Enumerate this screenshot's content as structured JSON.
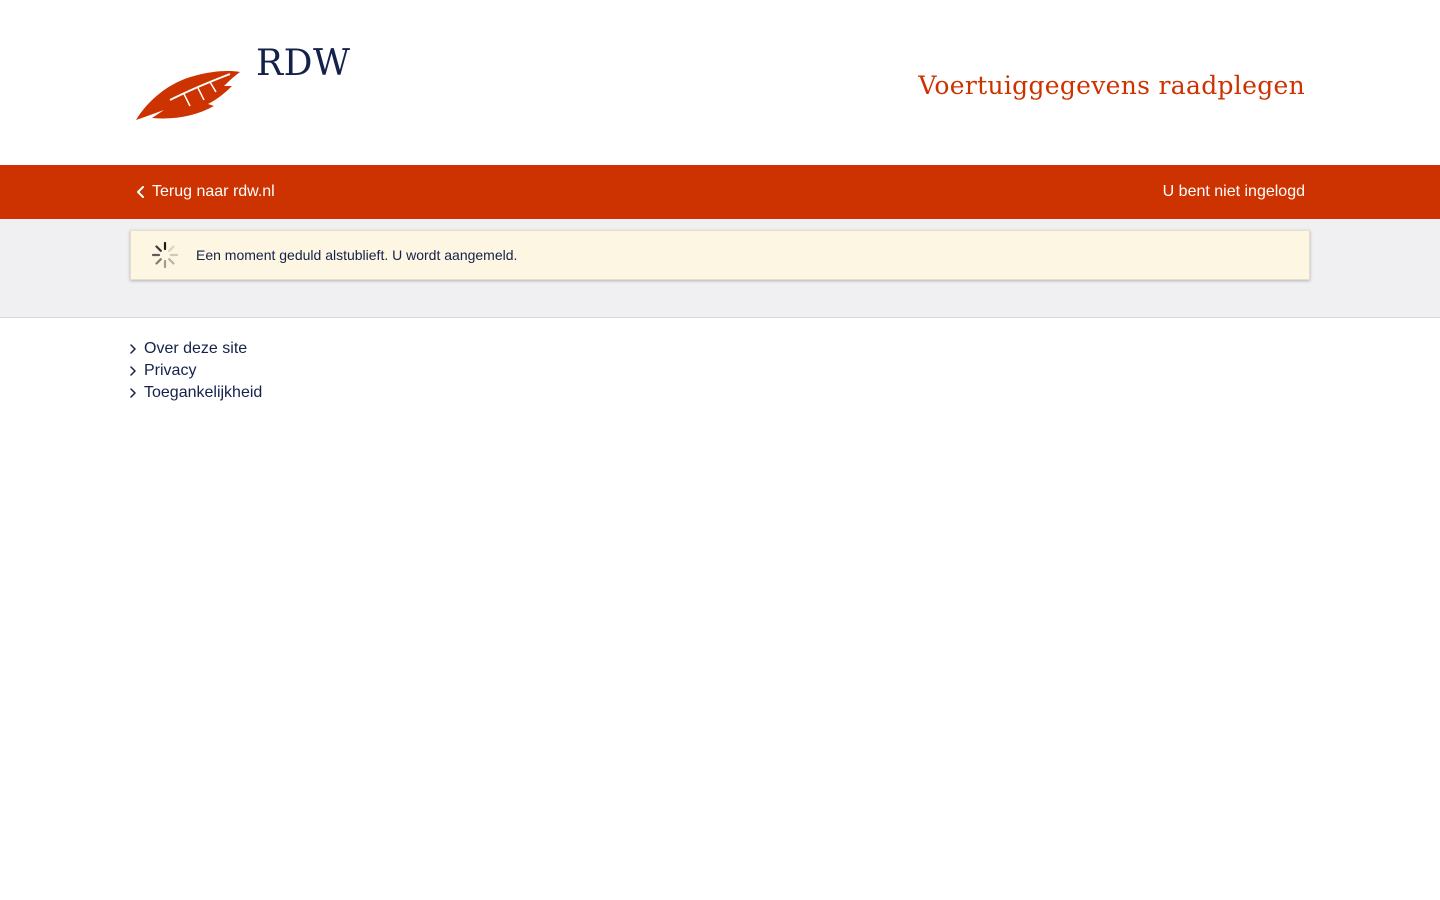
{
  "header": {
    "logo_text": "RDW",
    "site_title": "Voertuiggegevens raadplegen"
  },
  "navbar": {
    "back_label": "Terug naar rdw.nl",
    "login_status": "U bent niet ingelogd"
  },
  "notice": {
    "message": "Een moment geduld alstublieft. U wordt aangemeld.",
    "icon": "loading-spinner-icon"
  },
  "footer": {
    "links": [
      {
        "label": "Over deze site"
      },
      {
        "label": "Privacy"
      },
      {
        "label": "Toegankelijkheid"
      }
    ]
  },
  "colors": {
    "brand_orange": "#cc3300",
    "navy": "#14214a",
    "notice_bg": "#fdf6e2",
    "band_bg": "#f0f0f2"
  }
}
